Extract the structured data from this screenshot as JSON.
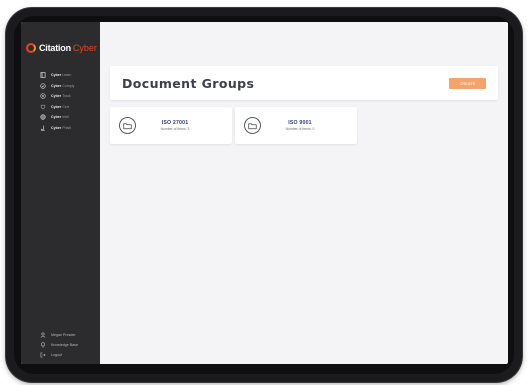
{
  "brand": {
    "name": "Citation",
    "accent": "Cyber"
  },
  "sidebar": {
    "items": [
      {
        "bold": "Cyber",
        "rest": "Learn",
        "icon": "book-icon"
      },
      {
        "bold": "Cyber",
        "rest": "Comply",
        "icon": "shield-check-icon"
      },
      {
        "bold": "Cyber",
        "rest": "Track",
        "icon": "target-icon"
      },
      {
        "bold": "Cyber",
        "rest": "Cert",
        "icon": "certificate-icon"
      },
      {
        "bold": "Cyber",
        "rest": "Intel",
        "icon": "globe-icon"
      },
      {
        "bold": "Cyber",
        "rest": "Phish",
        "icon": "hook-icon"
      }
    ],
    "bottom_items": [
      {
        "label": "Megan Presder",
        "icon": "user-icon"
      },
      {
        "label": "Knowledge Base",
        "icon": "lightbulb-icon"
      },
      {
        "label": "Logout",
        "icon": "logout-icon"
      }
    ]
  },
  "header": {
    "title": "Document Groups",
    "create_label": "CREATE"
  },
  "groups": [
    {
      "name": "ISO 27001",
      "count_text": "Number of Items: 3"
    },
    {
      "name": "ISO 9001",
      "count_text": "Number of Items: 0"
    }
  ],
  "colors": {
    "brand_accent": "#e8441e",
    "create_button": "#f4a46a",
    "group_title": "#2c3d7a"
  }
}
